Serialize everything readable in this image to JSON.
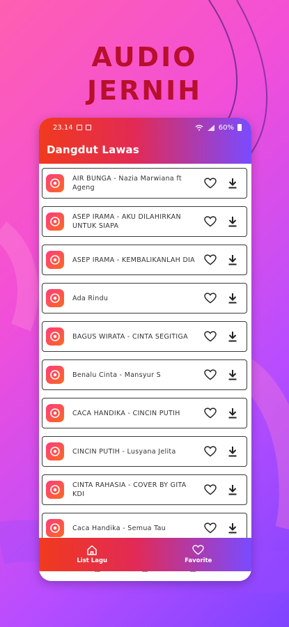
{
  "promo": {
    "line1": "AUDIO",
    "line2": "JERNIH"
  },
  "status": {
    "time": "23.14",
    "battery": "60%"
  },
  "app": {
    "title": "Dangdut Lawas"
  },
  "songs": [
    {
      "title": "AIR BUNGA - Nazia Marwiana ft Ageng"
    },
    {
      "title": "ASEP IRAMA - AKU DILAHIRKAN UNTUK SIAPA"
    },
    {
      "title": "ASEP IRAMA - KEMBALIKANLAH DIA"
    },
    {
      "title": "Ada Rindu"
    },
    {
      "title": "BAGUS WIRATA - CINTA SEGITIGA"
    },
    {
      "title": "Benalu Cinta - Mansyur S"
    },
    {
      "title": "CACA HANDIKA - CINCIN PUTIH"
    },
    {
      "title": "CINCIN PUTIH - Lusyana Jelita"
    },
    {
      "title": "CINTA RAHASIA - COVER BY GITA KDI"
    },
    {
      "title": "Caca Handika - Semua Tau"
    }
  ],
  "nav": {
    "list_label": "List Lagu",
    "favorite_label": "Favorite"
  },
  "colors": {
    "accent_red": "#f03a1e",
    "accent_purple": "#7a4bff",
    "promo_text": "#b80f2c"
  }
}
